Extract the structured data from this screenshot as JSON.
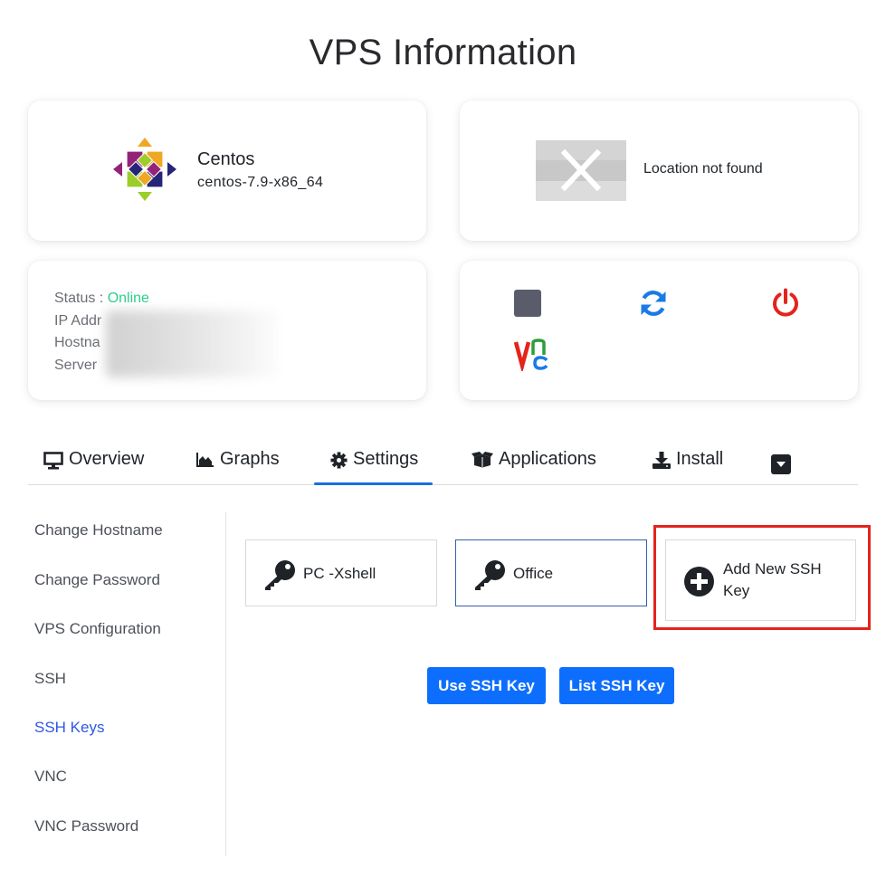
{
  "page": {
    "title": "VPS Information"
  },
  "os": {
    "name": "Centos",
    "version": "centos-7.9-x86_64"
  },
  "location": {
    "text": "Location not found"
  },
  "status": {
    "label": "Status : ",
    "value": "Online",
    "ip_label": "IP Addr",
    "hostname_label": "Hostna",
    "server_label": "Server"
  },
  "controls": {
    "vnc_icon": "vnc-icon",
    "stop_icon": "stop-icon",
    "restart_icon": "restart-icon",
    "power_icon": "power-icon"
  },
  "tabs": [
    {
      "label": "Overview",
      "icon": "monitor-icon"
    },
    {
      "label": "Graphs",
      "icon": "area-chart-icon"
    },
    {
      "label": "Settings",
      "icon": "gear-icon"
    },
    {
      "label": "Applications",
      "icon": "boxes-icon"
    },
    {
      "label": "Install",
      "icon": "download-icon"
    }
  ],
  "sidebar": {
    "items": [
      {
        "label": "Change Hostname"
      },
      {
        "label": "Change Password"
      },
      {
        "label": "VPS Configuration"
      },
      {
        "label": "SSH"
      },
      {
        "label": "SSH Keys"
      },
      {
        "label": "VNC"
      },
      {
        "label": "VNC Password"
      }
    ],
    "active": "SSH Keys"
  },
  "ssh_keys": {
    "keys": [
      {
        "label": "PC -Xshell"
      },
      {
        "label": "Office"
      }
    ],
    "add_label": "Add New SSH Key"
  },
  "buttons": {
    "use": "Use SSH Key",
    "list": "List SSH Key"
  },
  "colors": {
    "accent": "#0d6efd",
    "online": "#2ccf8b",
    "highlight": "#e4241c",
    "power": "#e4241c",
    "restart": "#1a7ae6"
  }
}
